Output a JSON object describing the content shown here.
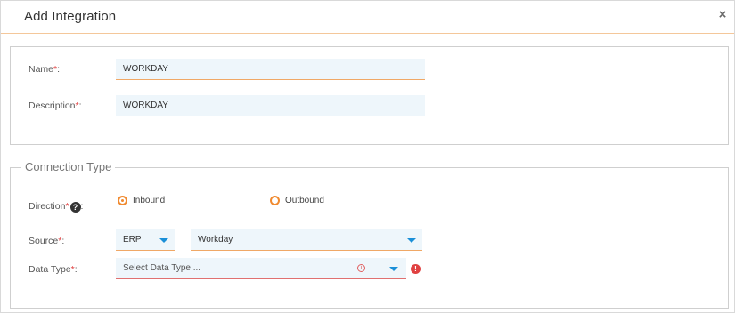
{
  "dialog": {
    "title": "Add Integration",
    "close_glyph": "×"
  },
  "form": {
    "name_label": "Name",
    "name_value": "WORKDAY",
    "description_label": "Description",
    "description_value": "WORKDAY",
    "required_marker": "*",
    "colon": ":"
  },
  "connection": {
    "legend": "Connection Type",
    "direction_label": "Direction",
    "help_glyph": "?",
    "inbound_label": "Inbound",
    "outbound_label": "Outbound",
    "selected_direction": "Inbound",
    "source_label": "Source",
    "source_type_value": "ERP",
    "source_system_value": "Workday",
    "data_type_label": "Data Type",
    "data_type_placeholder": "Select Data Type ...",
    "info_glyph": "i",
    "error_glyph": "!"
  },
  "colors": {
    "accent": "#f08a30",
    "caret": "#1a8fd8",
    "error": "#e04141",
    "input_bg": "#eef6fb"
  }
}
